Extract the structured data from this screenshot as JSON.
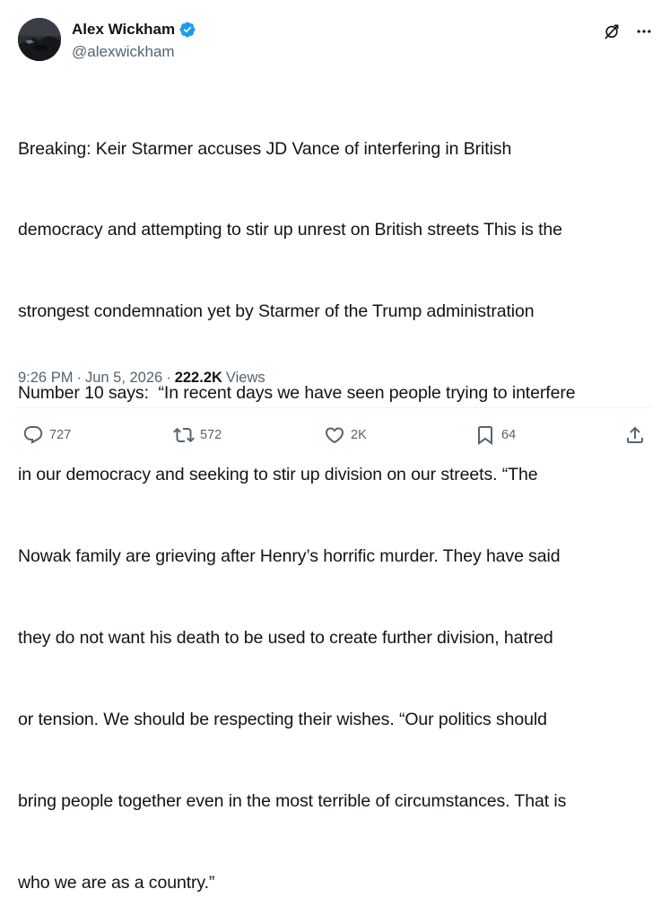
{
  "author": {
    "display_name": "Alex Wickham",
    "handle": "@alexwickham",
    "verified": true,
    "verified_color": "#1d9bf0"
  },
  "top_actions": {
    "grok_icon": "grok-icon",
    "more_icon": "more-icon",
    "more_label": "···"
  },
  "tweet": {
    "lines": [
      "Breaking: Keir Starmer accuses JD Vance of interfering in British",
      "democracy and attempting to stir up unrest on British streets This is the",
      "strongest condemnation yet by Starmer of the Trump administration",
      "Number 10 says:  “In recent days we have seen people trying to interfere",
      "in our democracy and seeking to stir up division on our streets. “The",
      "Nowak family are grieving after Henry’s horrific murder. They have said",
      "they do not want his death to be used to create further division, hatred",
      "or tension. We should be respecting their wishes. “Our politics should",
      "bring people together even in the most terrible of circumstances. That is",
      "who we are as a country.”"
    ]
  },
  "meta": {
    "time": "9:26 PM",
    "separator": "·",
    "date": "Jun 5, 2026",
    "views_count": "222.2K",
    "views_label": "Views"
  },
  "actions": {
    "reply_count": "727",
    "retweet_count": "572",
    "like_count": "2K",
    "bookmark_count": "64"
  },
  "colors": {
    "text": "#0f1419",
    "secondary": "#536471",
    "divider": "#eff3f4",
    "accent": "#1d9bf0"
  }
}
